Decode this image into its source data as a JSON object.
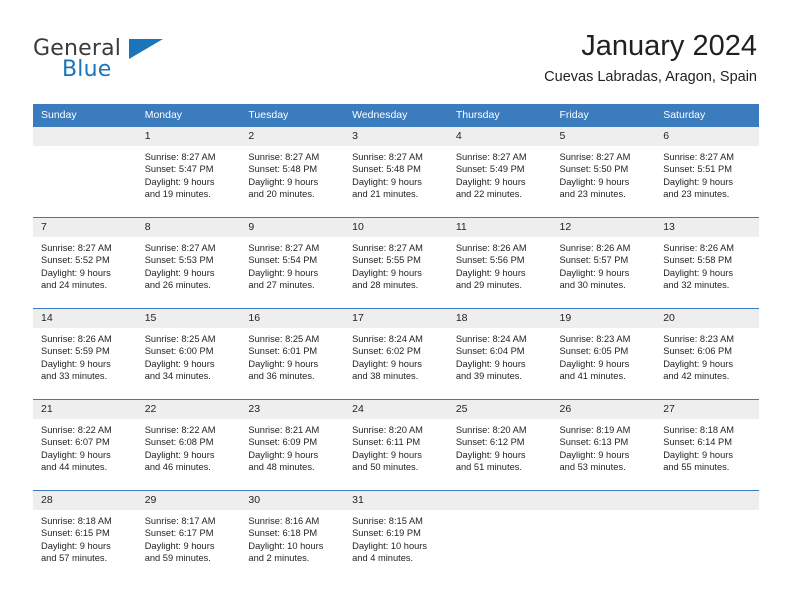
{
  "brand": {
    "name_part1": "General",
    "name_part2": "Blue",
    "accent_color": "#1b75bb"
  },
  "header": {
    "title": "January 2024",
    "subtitle": "Cuevas Labradas, Aragon, Spain"
  },
  "theme": {
    "header_row_bg": "#3a7cbe",
    "daynum_bg": "#eeeeee",
    "text_color": "#231f20"
  },
  "weekdays": [
    "Sunday",
    "Monday",
    "Tuesday",
    "Wednesday",
    "Thursday",
    "Friday",
    "Saturday"
  ],
  "weeks": [
    [
      {
        "day": "",
        "sunrise": "",
        "sunset": "",
        "daylight1": "",
        "daylight2": ""
      },
      {
        "day": "1",
        "sunrise": "Sunrise: 8:27 AM",
        "sunset": "Sunset: 5:47 PM",
        "daylight1": "Daylight: 9 hours",
        "daylight2": "and 19 minutes."
      },
      {
        "day": "2",
        "sunrise": "Sunrise: 8:27 AM",
        "sunset": "Sunset: 5:48 PM",
        "daylight1": "Daylight: 9 hours",
        "daylight2": "and 20 minutes."
      },
      {
        "day": "3",
        "sunrise": "Sunrise: 8:27 AM",
        "sunset": "Sunset: 5:48 PM",
        "daylight1": "Daylight: 9 hours",
        "daylight2": "and 21 minutes."
      },
      {
        "day": "4",
        "sunrise": "Sunrise: 8:27 AM",
        "sunset": "Sunset: 5:49 PM",
        "daylight1": "Daylight: 9 hours",
        "daylight2": "and 22 minutes."
      },
      {
        "day": "5",
        "sunrise": "Sunrise: 8:27 AM",
        "sunset": "Sunset: 5:50 PM",
        "daylight1": "Daylight: 9 hours",
        "daylight2": "and 23 minutes."
      },
      {
        "day": "6",
        "sunrise": "Sunrise: 8:27 AM",
        "sunset": "Sunset: 5:51 PM",
        "daylight1": "Daylight: 9 hours",
        "daylight2": "and 23 minutes."
      }
    ],
    [
      {
        "day": "7",
        "sunrise": "Sunrise: 8:27 AM",
        "sunset": "Sunset: 5:52 PM",
        "daylight1": "Daylight: 9 hours",
        "daylight2": "and 24 minutes."
      },
      {
        "day": "8",
        "sunrise": "Sunrise: 8:27 AM",
        "sunset": "Sunset: 5:53 PM",
        "daylight1": "Daylight: 9 hours",
        "daylight2": "and 26 minutes."
      },
      {
        "day": "9",
        "sunrise": "Sunrise: 8:27 AM",
        "sunset": "Sunset: 5:54 PM",
        "daylight1": "Daylight: 9 hours",
        "daylight2": "and 27 minutes."
      },
      {
        "day": "10",
        "sunrise": "Sunrise: 8:27 AM",
        "sunset": "Sunset: 5:55 PM",
        "daylight1": "Daylight: 9 hours",
        "daylight2": "and 28 minutes."
      },
      {
        "day": "11",
        "sunrise": "Sunrise: 8:26 AM",
        "sunset": "Sunset: 5:56 PM",
        "daylight1": "Daylight: 9 hours",
        "daylight2": "and 29 minutes."
      },
      {
        "day": "12",
        "sunrise": "Sunrise: 8:26 AM",
        "sunset": "Sunset: 5:57 PM",
        "daylight1": "Daylight: 9 hours",
        "daylight2": "and 30 minutes."
      },
      {
        "day": "13",
        "sunrise": "Sunrise: 8:26 AM",
        "sunset": "Sunset: 5:58 PM",
        "daylight1": "Daylight: 9 hours",
        "daylight2": "and 32 minutes."
      }
    ],
    [
      {
        "day": "14",
        "sunrise": "Sunrise: 8:26 AM",
        "sunset": "Sunset: 5:59 PM",
        "daylight1": "Daylight: 9 hours",
        "daylight2": "and 33 minutes."
      },
      {
        "day": "15",
        "sunrise": "Sunrise: 8:25 AM",
        "sunset": "Sunset: 6:00 PM",
        "daylight1": "Daylight: 9 hours",
        "daylight2": "and 34 minutes."
      },
      {
        "day": "16",
        "sunrise": "Sunrise: 8:25 AM",
        "sunset": "Sunset: 6:01 PM",
        "daylight1": "Daylight: 9 hours",
        "daylight2": "and 36 minutes."
      },
      {
        "day": "17",
        "sunrise": "Sunrise: 8:24 AM",
        "sunset": "Sunset: 6:02 PM",
        "daylight1": "Daylight: 9 hours",
        "daylight2": "and 38 minutes."
      },
      {
        "day": "18",
        "sunrise": "Sunrise: 8:24 AM",
        "sunset": "Sunset: 6:04 PM",
        "daylight1": "Daylight: 9 hours",
        "daylight2": "and 39 minutes."
      },
      {
        "day": "19",
        "sunrise": "Sunrise: 8:23 AM",
        "sunset": "Sunset: 6:05 PM",
        "daylight1": "Daylight: 9 hours",
        "daylight2": "and 41 minutes."
      },
      {
        "day": "20",
        "sunrise": "Sunrise: 8:23 AM",
        "sunset": "Sunset: 6:06 PM",
        "daylight1": "Daylight: 9 hours",
        "daylight2": "and 42 minutes."
      }
    ],
    [
      {
        "day": "21",
        "sunrise": "Sunrise: 8:22 AM",
        "sunset": "Sunset: 6:07 PM",
        "daylight1": "Daylight: 9 hours",
        "daylight2": "and 44 minutes."
      },
      {
        "day": "22",
        "sunrise": "Sunrise: 8:22 AM",
        "sunset": "Sunset: 6:08 PM",
        "daylight1": "Daylight: 9 hours",
        "daylight2": "and 46 minutes."
      },
      {
        "day": "23",
        "sunrise": "Sunrise: 8:21 AM",
        "sunset": "Sunset: 6:09 PM",
        "daylight1": "Daylight: 9 hours",
        "daylight2": "and 48 minutes."
      },
      {
        "day": "24",
        "sunrise": "Sunrise: 8:20 AM",
        "sunset": "Sunset: 6:11 PM",
        "daylight1": "Daylight: 9 hours",
        "daylight2": "and 50 minutes."
      },
      {
        "day": "25",
        "sunrise": "Sunrise: 8:20 AM",
        "sunset": "Sunset: 6:12 PM",
        "daylight1": "Daylight: 9 hours",
        "daylight2": "and 51 minutes."
      },
      {
        "day": "26",
        "sunrise": "Sunrise: 8:19 AM",
        "sunset": "Sunset: 6:13 PM",
        "daylight1": "Daylight: 9 hours",
        "daylight2": "and 53 minutes."
      },
      {
        "day": "27",
        "sunrise": "Sunrise: 8:18 AM",
        "sunset": "Sunset: 6:14 PM",
        "daylight1": "Daylight: 9 hours",
        "daylight2": "and 55 minutes."
      }
    ],
    [
      {
        "day": "28",
        "sunrise": "Sunrise: 8:18 AM",
        "sunset": "Sunset: 6:15 PM",
        "daylight1": "Daylight: 9 hours",
        "daylight2": "and 57 minutes."
      },
      {
        "day": "29",
        "sunrise": "Sunrise: 8:17 AM",
        "sunset": "Sunset: 6:17 PM",
        "daylight1": "Daylight: 9 hours",
        "daylight2": "and 59 minutes."
      },
      {
        "day": "30",
        "sunrise": "Sunrise: 8:16 AM",
        "sunset": "Sunset: 6:18 PM",
        "daylight1": "Daylight: 10 hours",
        "daylight2": "and 2 minutes."
      },
      {
        "day": "31",
        "sunrise": "Sunrise: 8:15 AM",
        "sunset": "Sunset: 6:19 PM",
        "daylight1": "Daylight: 10 hours",
        "daylight2": "and 4 minutes."
      },
      {
        "day": "",
        "sunrise": "",
        "sunset": "",
        "daylight1": "",
        "daylight2": ""
      },
      {
        "day": "",
        "sunrise": "",
        "sunset": "",
        "daylight1": "",
        "daylight2": ""
      },
      {
        "day": "",
        "sunrise": "",
        "sunset": "",
        "daylight1": "",
        "daylight2": ""
      }
    ]
  ]
}
